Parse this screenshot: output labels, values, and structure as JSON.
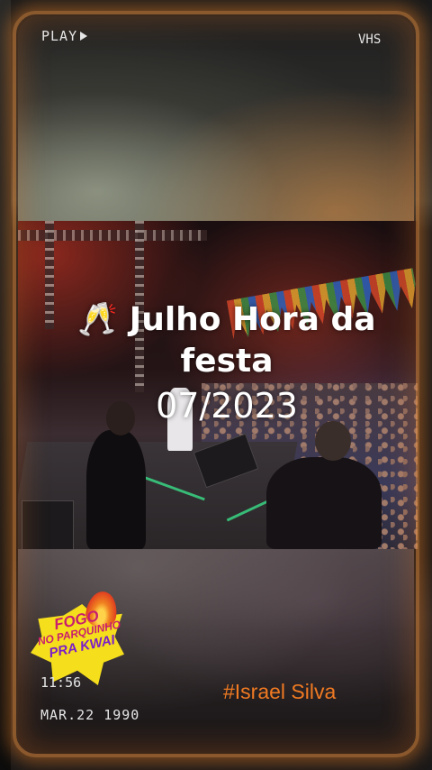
{
  "overlay": {
    "play_label": "PLAY",
    "format_label": "VHS",
    "time": "11:56",
    "date": "MAR.22 1990"
  },
  "caption": {
    "line1_emoji": "🥂",
    "line1_text": "Julho Hora da",
    "line2_text": "festa",
    "line3_text": "07/2023"
  },
  "hashtag": "#Israel Silva",
  "sticker": {
    "line1": "FOGO",
    "line2": "NO PARQUINHO",
    "line3": "PRA KWAI"
  },
  "colors": {
    "frame_glow": "#f08a32",
    "hashtag": "#f07a22",
    "sticker_yellow": "#f5de1c",
    "sticker_magenta": "#c81e6e",
    "sticker_purple": "#7a1ec8"
  },
  "icons": {
    "play": "play-triangle-icon",
    "sticker_flame": "flame-icon",
    "emoji": "clinking-glasses-icon"
  }
}
